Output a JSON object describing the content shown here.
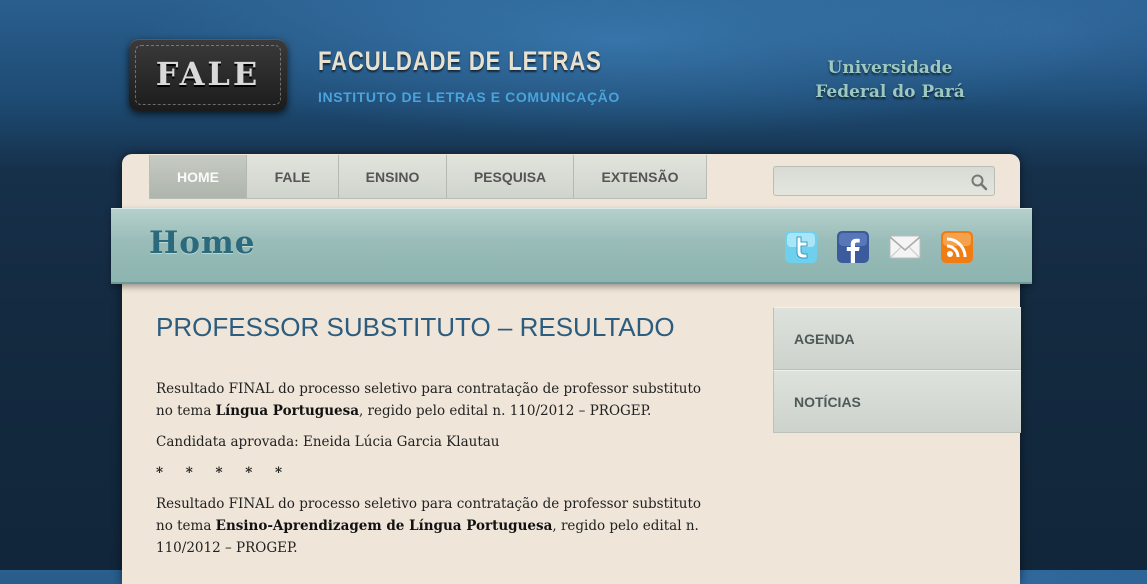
{
  "header": {
    "logo_text": "FALE",
    "faculty_title": "FACULDADE DE LETRAS",
    "faculty_subtitle": "INSTITUTO DE LETRAS E COMUNICAÇÃO",
    "university_line1": "Universidade",
    "university_line2": "Federal do Pará"
  },
  "nav": {
    "items": [
      {
        "label": "HOME",
        "active": true
      },
      {
        "label": "FALE",
        "active": false
      },
      {
        "label": "ENSINO",
        "active": false
      },
      {
        "label": "PESQUISA",
        "active": false
      },
      {
        "label": "EXTENSÃO",
        "active": false
      }
    ]
  },
  "search": {
    "value": "",
    "placeholder": "",
    "icon": "search-icon"
  },
  "banner": {
    "title": "Home",
    "social_icons": [
      "twitter-icon",
      "facebook-icon",
      "email-icon",
      "rss-icon"
    ]
  },
  "post": {
    "title": "PROFESSOR SUBSTITUTO – RESULTADO",
    "p1_a": "Resultado FINAL do processo seletivo para contratação de professor substituto no tema ",
    "p1_bold": "Língua Portuguesa",
    "p1_b": ", regido pelo edital n. 110/2012 – PROGEP.",
    "p2": "Candidata aprovada: Eneida Lúcia Garcia Klautau",
    "stars": "* * * * *",
    "p3_a": "Resultado FINAL do processo seletivo para contratação de professor substituto no tema ",
    "p3_bold": "Ensino-Aprendizagem de Língua Portuguesa",
    "p3_b": ", regido pelo edital n. 110/2012 – PROGEP."
  },
  "sidebar": {
    "items": [
      {
        "label": "AGENDA"
      },
      {
        "label": "NOTÍCIAS"
      }
    ]
  },
  "colors": {
    "accent_blue": "#4aa3dc",
    "post_title": "#2d5d7e",
    "banner_teal": "#99bcb8",
    "paper": "#efe5d9"
  }
}
